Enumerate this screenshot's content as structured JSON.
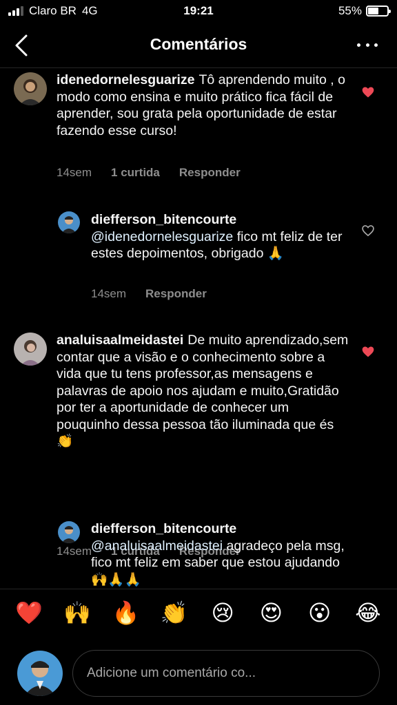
{
  "status_bar": {
    "carrier": "Claro BR",
    "network": "4G",
    "time": "19:21",
    "battery": "55%",
    "battery_level": 0.55
  },
  "header": {
    "title": "Comentários",
    "back_icon": "chevron-left-icon",
    "more_icon": "more-horizontal-icon"
  },
  "comments": [
    {
      "username": "idenedornelesguarize",
      "text": "Tô aprendendo muito , o modo como ensina e muito prático fica fácil de aprender, sou grata pela oportunidade de estar fazendo esse curso!",
      "time": "14sem",
      "likes": "1 curtida",
      "reply": "Responder",
      "liked": true,
      "reply_to": null
    },
    {
      "username": "diefferson_bitencourte",
      "mention": "@idenedornelesguarize",
      "text": "fico mt feliz de ter estes depoimentos, obrigado 🙏",
      "time": "14sem",
      "likes": "",
      "reply": "Responder",
      "liked": false
    },
    {
      "username": "analuisaalmeidastei",
      "text": "De muito aprendizado,sem contar que a visão e o conhecimento sobre a vida que tu tens professor,as mensagens e palavras de apoio nos ajudam e muito,Gratidão por ter a aportunidade de conhecer um pouquinho dessa pessoa tão iluminada que és👏",
      "time": "14sem",
      "likes": "1 curtida",
      "reply": "Responder",
      "liked": true
    },
    {
      "username": "diefferson_bitencourte",
      "mention": "@analuisaalmeidastei",
      "text": "agradeço pela msg, fico mt feliz em saber que estou ajudando 🙌🙏🙏",
      "liked": false
    }
  ],
  "reactions": [
    "❤️",
    "🙌",
    "🔥",
    "👏",
    "😢",
    "😍",
    "😮",
    "😂"
  ],
  "composer": {
    "placeholder": "Adicione um comentário co..."
  },
  "colors": {
    "background": "#000000",
    "like_red": "#ed4956",
    "meta_gray": "#8e8e8e"
  }
}
